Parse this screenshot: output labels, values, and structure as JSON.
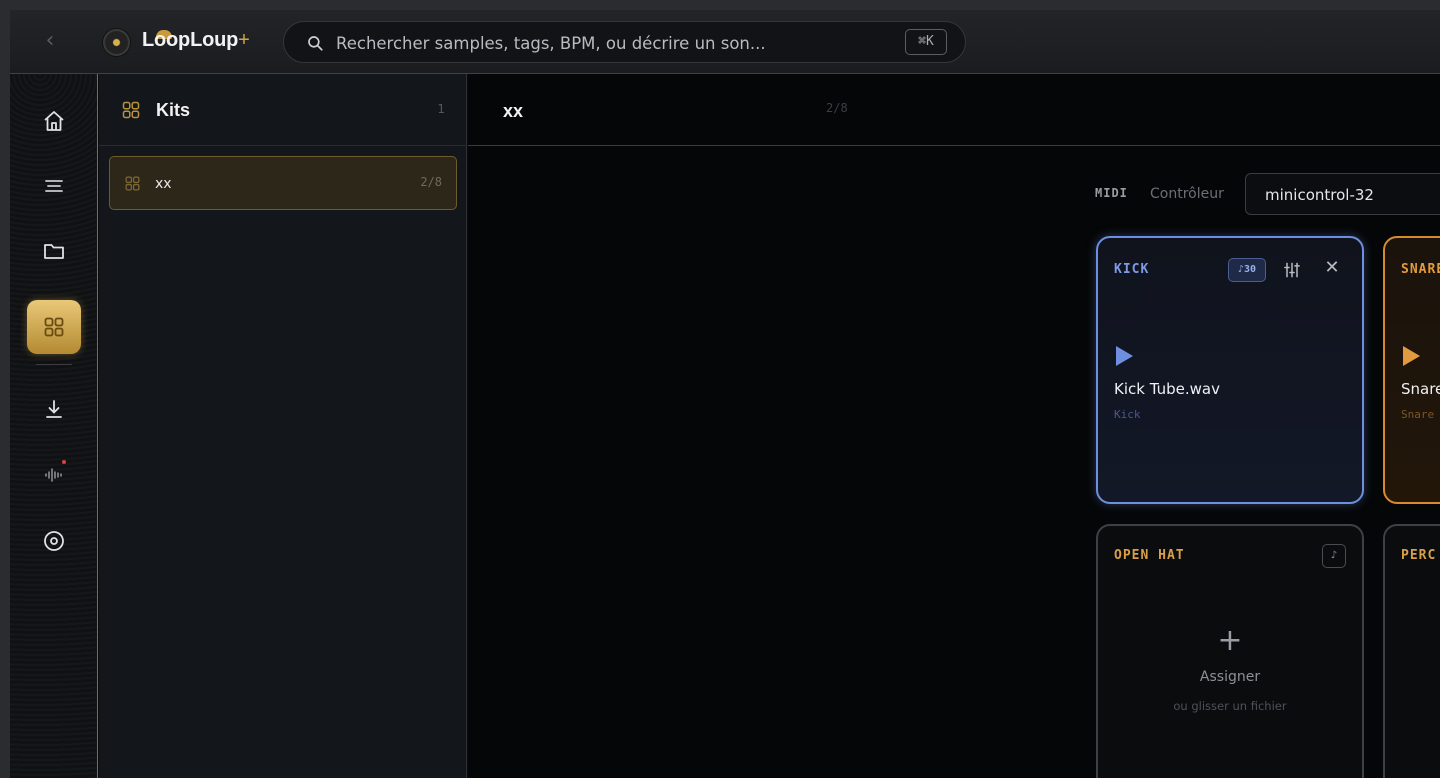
{
  "app": {
    "name": "LoopLoup",
    "plus": "+"
  },
  "search": {
    "placeholder": "Rechercher samples, tags, BPM, ou décrire un son...",
    "shortcut": "⌘K"
  },
  "rail": {
    "items": [
      {
        "icon": "home-icon"
      },
      {
        "icon": "list-icon"
      },
      {
        "icon": "folder-icon"
      },
      {
        "icon": "kits-grid-icon",
        "active": true
      },
      {
        "icon": "download-icon"
      },
      {
        "icon": "waveform-record-icon"
      },
      {
        "icon": "disc-icon"
      }
    ]
  },
  "kits": {
    "title": "Kits",
    "count": "1",
    "items": [
      {
        "name": "xx",
        "count": "2/8"
      }
    ]
  },
  "main": {
    "title": "xx",
    "count": "2/8",
    "midi_label": "MIDI",
    "controller_label": "Contrôleur",
    "controller_value": "minicontrol-32"
  },
  "pads": {
    "kick": {
      "name": "KICK",
      "badge": "♪30",
      "file": "Kick Tube.wav",
      "tag": "Kick"
    },
    "snare": {
      "name": "SNARE",
      "file": "Snare",
      "tag": "Snare"
    },
    "openhat": {
      "name": "OPEN HAT",
      "midi": "♪",
      "plus": "+",
      "assign": "Assigner",
      "drop": "ou glisser un fichier"
    },
    "perc": {
      "name": "PERC"
    }
  },
  "colors": {
    "accent_gold": "#d2a548",
    "kick_blue": "#6e8fe0",
    "snare_orange": "#e29a3e"
  }
}
